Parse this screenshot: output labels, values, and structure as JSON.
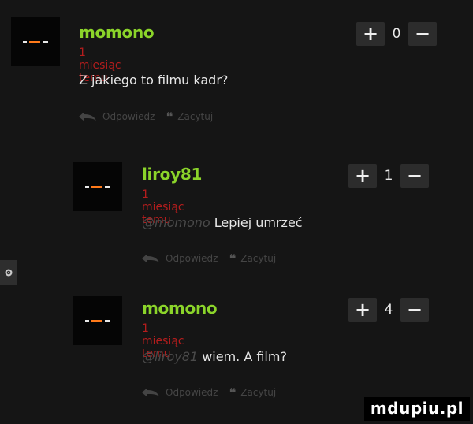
{
  "comments": [
    {
      "username": "momono",
      "time": "1 miesiąc temu",
      "body": "Z jakiego to filmu kadr?",
      "mention": "",
      "score": "0",
      "reply_label": "Odpowiedz",
      "quote_label": "Zacytuj"
    },
    {
      "username": "liroy81",
      "time": "1 miesiąc temu",
      "mention": "@momono",
      "body": "Lepiej umrzeć",
      "score": "1",
      "reply_label": "Odpowiedz",
      "quote_label": "Zacytuj"
    },
    {
      "username": "momono",
      "time": "1 miesiąc temu",
      "mention": "@liroy81",
      "body": "wiem. A film?",
      "score": "4",
      "reply_label": "Odpowiedz",
      "quote_label": "Zacytuj"
    }
  ],
  "vote": {
    "plus": "+",
    "minus": "−"
  },
  "icons": {
    "reply": "reply-arrow-icon",
    "quote": "quote-icon",
    "settings": "gear-icon"
  },
  "watermark": "mdupiu.pl",
  "colors": {
    "username": "#8bd42a",
    "time": "#b51d1d",
    "background": "#151515"
  }
}
